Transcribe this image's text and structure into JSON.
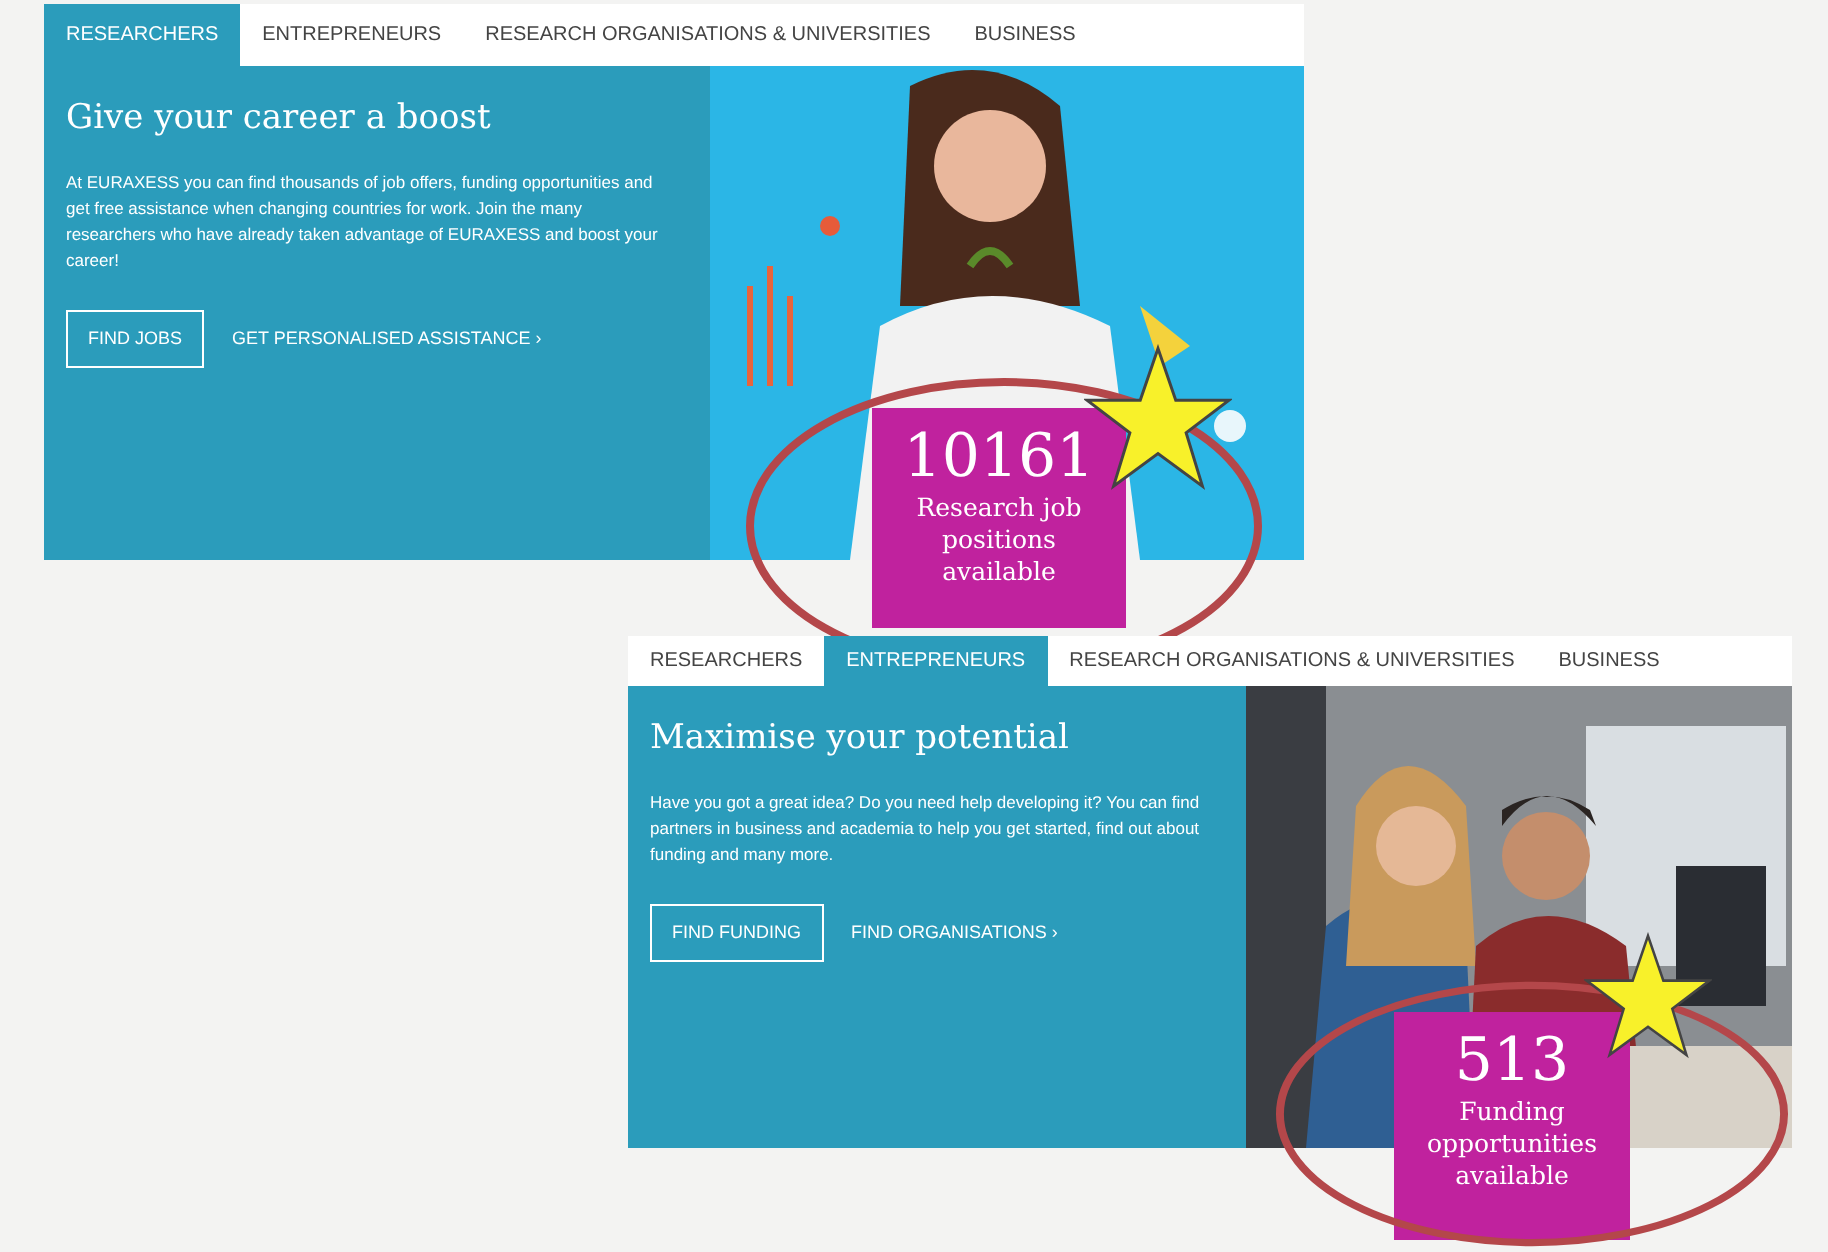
{
  "panels": [
    {
      "tabs": [
        {
          "label": "RESEARCHERS",
          "selected": true
        },
        {
          "label": "ENTREPRENEURS",
          "selected": false
        },
        {
          "label": "RESEARCH ORGANISATIONS & UNIVERSITIES",
          "selected": false
        },
        {
          "label": "BUSINESS",
          "selected": false
        }
      ],
      "title": "Give your career a boost",
      "body": "At EURAXESS you can find thousands of job offers, funding opportunities and get free assistance when changing countries for work. Join the many researchers who have already taken advantage of EURAXESS and boost your career!",
      "actions": [
        {
          "label": "FIND JOBS",
          "kind": "outline"
        },
        {
          "label": "GET PERSONALISED ASSISTANCE ›",
          "kind": "link"
        }
      ],
      "stat": {
        "value": "10161",
        "label": "Research job positions available"
      }
    },
    {
      "tabs": [
        {
          "label": "RESEARCHERS",
          "selected": false
        },
        {
          "label": "ENTREPRENEURS",
          "selected": true
        },
        {
          "label": "RESEARCH ORGANISATIONS & UNIVERSITIES",
          "selected": false
        },
        {
          "label": "BUSINESS",
          "selected": false
        }
      ],
      "title": "Maximise your potential",
      "body": "Have you got a great idea? Do you need help developing it? You can find partners in business and academia to help you get started, find out about funding and many more.",
      "actions": [
        {
          "label": "FIND FUNDING",
          "kind": "outline"
        },
        {
          "label": "FIND ORGANISATIONS ›",
          "kind": "link"
        }
      ],
      "stat": {
        "value": "513",
        "label": "Funding opportunities available"
      }
    }
  ]
}
